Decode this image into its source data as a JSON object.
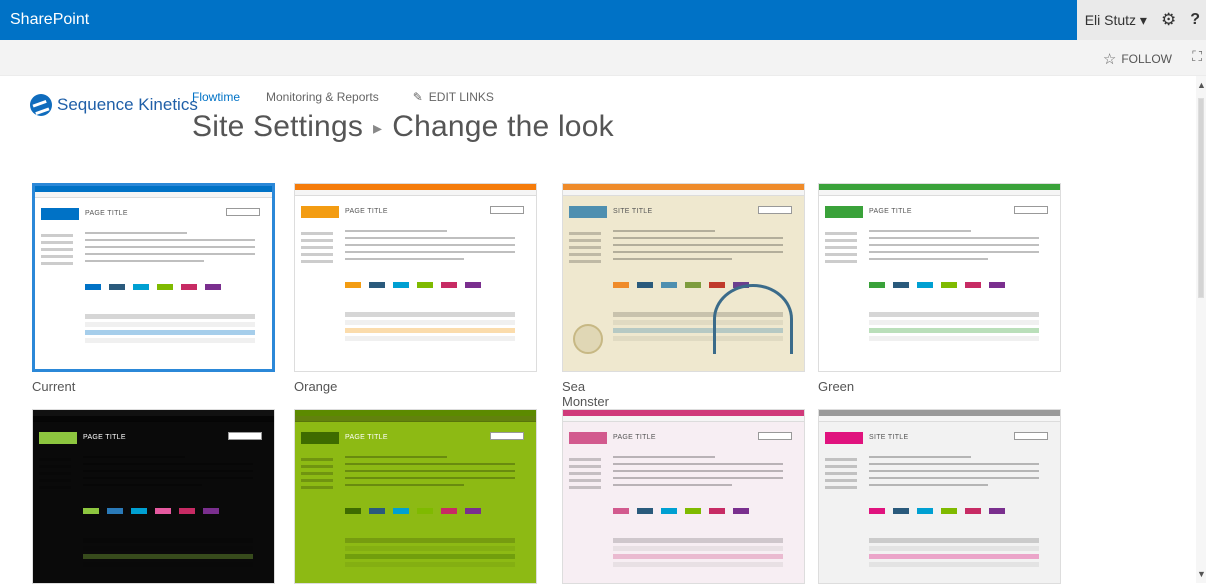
{
  "suite": {
    "brand": "SharePoint",
    "user": "Eli Stutz ▾",
    "settings_icon": "gear-icon",
    "help_label": "?"
  },
  "ribbon": {
    "follow_label": "FOLLOW",
    "focus_icon": "focus-icon"
  },
  "site": {
    "logo_text": "Sequence Kinetics"
  },
  "topnav": {
    "items": [
      "Flowtime",
      "Monitoring & Reports"
    ],
    "edit_links": "EDIT LINKS"
  },
  "title": {
    "part1": "Site Settings",
    "part2": "Change the look"
  },
  "looks": [
    {
      "name": "Current",
      "page_title": "PAGE TITLE",
      "bg": "#ffffff",
      "bar": "#0072c6",
      "accent": "#0072c6",
      "selected": true,
      "swatches": [
        "#0072c6",
        "#2a5a7c",
        "#00a0d2",
        "#7fba00",
        "#c72b64",
        "#7a2f8e"
      ]
    },
    {
      "name": "Orange",
      "page_title": "PAGE TITLE",
      "bg": "#ffffff",
      "bar": "#f57c0b",
      "accent": "#f39c12",
      "swatches": [
        "#f39c12",
        "#2a5a7c",
        "#00a0d2",
        "#7fba00",
        "#c72b64",
        "#7a2f8e"
      ]
    },
    {
      "name": "Sea Monster",
      "page_title": "SITE TITLE",
      "bg": "#efe8cf",
      "bar": "#ef8b2a",
      "accent": "#4e8fb0",
      "swatches": [
        "#ef8b2a",
        "#2a5a7c",
        "#4e8fb0",
        "#7e9c3e",
        "#c03a2b",
        "#6b3f8e"
      ]
    },
    {
      "name": "Green",
      "page_title": "PAGE TITLE",
      "bg": "#ffffff",
      "bar": "#3aa23a",
      "accent": "#3aa23a",
      "swatches": [
        "#3aa23a",
        "#2a5a7c",
        "#00a0d2",
        "#7fba00",
        "#c72b64",
        "#7a2f8e"
      ]
    },
    {
      "name": "",
      "page_title": "PAGE TITLE",
      "bg": "#0a0a0a",
      "bar": "#111111",
      "accent": "#8dc63f",
      "swatches": [
        "#8dc63f",
        "#2a7ab8",
        "#00a0d2",
        "#e65aa0",
        "#c72b64",
        "#7a2f8e"
      ]
    },
    {
      "name": "",
      "page_title": "PAGE TITLE",
      "bg": "#8dba14",
      "bar": "#5c8a00",
      "accent": "#3e6b00",
      "swatches": [
        "#3e6b00",
        "#2a5a7c",
        "#00a0d2",
        "#7fba00",
        "#c72b64",
        "#7a2f8e"
      ]
    },
    {
      "name": "",
      "page_title": "PAGE TITLE",
      "bg": "#f7eef3",
      "bar": "#d03a7a",
      "accent": "#d25a8e",
      "swatches": [
        "#d25a8e",
        "#2a5a7c",
        "#00a0d2",
        "#7fba00",
        "#c72b64",
        "#7a2f8e"
      ]
    },
    {
      "name": "",
      "page_title": "SITE TITLE",
      "bg": "#f2f2f2",
      "bar": "#9a9a9a",
      "accent": "#e0137e",
      "swatches": [
        "#e0137e",
        "#2a5a7c",
        "#00a0d2",
        "#7fba00",
        "#c72b64",
        "#7a2f8e"
      ]
    }
  ]
}
